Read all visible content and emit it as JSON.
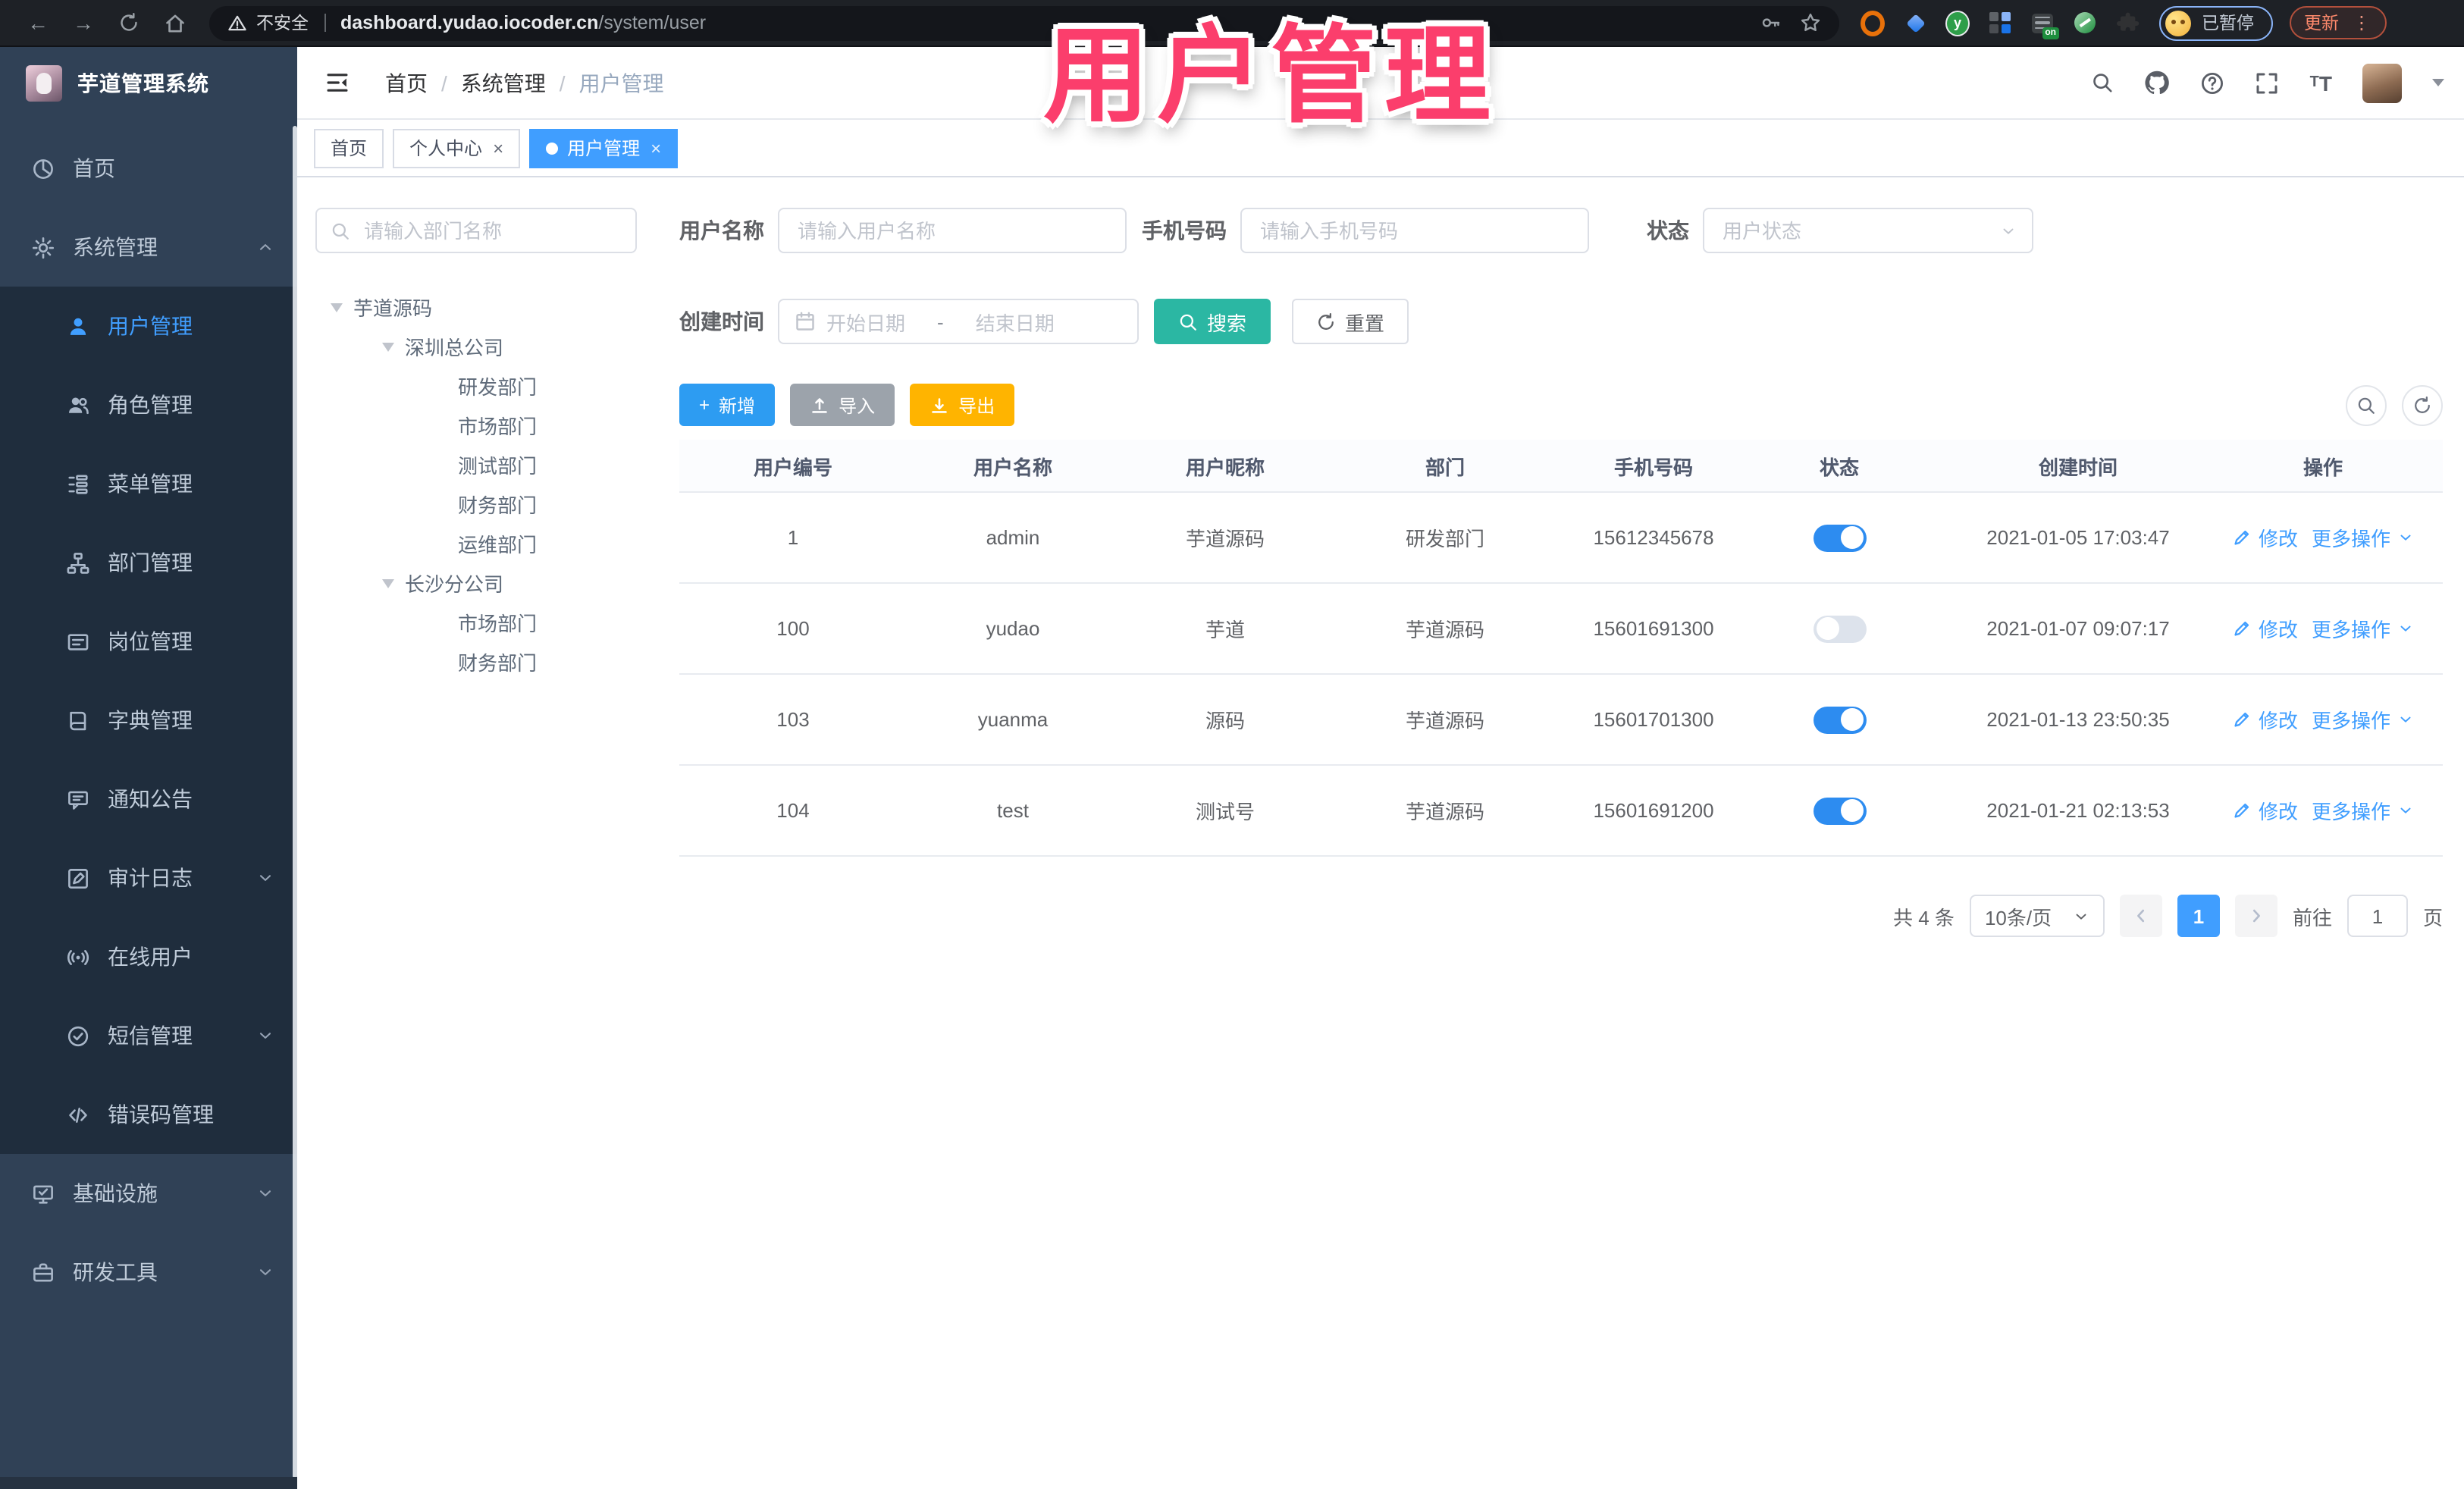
{
  "overlay": {
    "title": "用户管理"
  },
  "theme": {
    "primary": "#409eff",
    "search_button": "#2bb7a3",
    "add_button": "#2d9cf2",
    "import_button": "#9ca3ab",
    "export_button": "#ffb400",
    "overlay_pink": "#fb3e6c",
    "sidebar_bg": "#304156",
    "submenu_bg": "#1f2d3d",
    "toggle_on": "#2d8cf0"
  },
  "browser": {
    "security_label": "不安全",
    "url_host": "dashboard.yudao.iocoder.cn",
    "url_path": "/system/user",
    "profile_status": "已暂停",
    "update_label": "更新"
  },
  "app_header": {
    "logo_title": "芋道管理系统",
    "breadcrumb": [
      "首页",
      "系统管理",
      "用户管理"
    ]
  },
  "tabs": [
    {
      "label": "首页",
      "active": false,
      "closable": false
    },
    {
      "label": "个人中心",
      "active": false,
      "closable": true
    },
    {
      "label": "用户管理",
      "active": true,
      "closable": true
    }
  ],
  "sidebar": {
    "items": [
      {
        "label": "首页",
        "icon": "dashboard-icon",
        "level": "top"
      },
      {
        "label": "系统管理",
        "icon": "gear-icon",
        "level": "top",
        "chevron": "up"
      },
      {
        "label": "用户管理",
        "icon": "user-icon",
        "level": "sub",
        "active": true
      },
      {
        "label": "角色管理",
        "icon": "role-icon",
        "level": "sub"
      },
      {
        "label": "菜单管理",
        "icon": "menu-icon",
        "level": "sub"
      },
      {
        "label": "部门管理",
        "icon": "dept-icon",
        "level": "sub"
      },
      {
        "label": "岗位管理",
        "icon": "post-icon",
        "level": "sub"
      },
      {
        "label": "字典管理",
        "icon": "dict-icon",
        "level": "sub"
      },
      {
        "label": "通知公告",
        "icon": "notice-icon",
        "level": "sub"
      },
      {
        "label": "审计日志",
        "icon": "audit-icon",
        "level": "sub",
        "chevron": "down"
      },
      {
        "label": "在线用户",
        "icon": "online-icon",
        "level": "sub"
      },
      {
        "label": "短信管理",
        "icon": "sms-icon",
        "level": "sub",
        "chevron": "down"
      },
      {
        "label": "错误码管理",
        "icon": "errcode-icon",
        "level": "sub"
      },
      {
        "label": "基础设施",
        "icon": "infra-icon",
        "level": "top",
        "chevron": "down"
      },
      {
        "label": "研发工具",
        "icon": "devtool-icon",
        "level": "top",
        "chevron": "down"
      }
    ]
  },
  "dept_panel": {
    "search_placeholder": "请输入部门名称",
    "tree": [
      {
        "label": "芋道源码",
        "level": 0,
        "caret": true
      },
      {
        "label": "深圳总公司",
        "level": 1,
        "caret": true
      },
      {
        "label": "研发部门",
        "level": 2,
        "caret": false
      },
      {
        "label": "市场部门",
        "level": 2,
        "caret": false
      },
      {
        "label": "测试部门",
        "level": 2,
        "caret": false
      },
      {
        "label": "财务部门",
        "level": 2,
        "caret": false
      },
      {
        "label": "运维部门",
        "level": 2,
        "caret": false
      },
      {
        "label": "长沙分公司",
        "level": 1,
        "caret": true
      },
      {
        "label": "市场部门",
        "level": 2,
        "caret": false
      },
      {
        "label": "财务部门",
        "level": 2,
        "caret": false
      }
    ]
  },
  "filters": {
    "username_label": "用户名称",
    "username_placeholder": "请输入用户名称",
    "mobile_label": "手机号码",
    "mobile_placeholder": "请输入手机号码",
    "status_label": "状态",
    "status_placeholder": "用户状态",
    "create_time_label": "创建时间",
    "date_start_placeholder": "开始日期",
    "date_separator": "-",
    "date_end_placeholder": "结束日期",
    "search_label": "搜索",
    "reset_label": "重置"
  },
  "toolbar": {
    "add_label": "新增",
    "import_label": "导入",
    "export_label": "导出"
  },
  "table": {
    "columns": [
      "用户编号",
      "用户名称",
      "用户昵称",
      "部门",
      "手机号码",
      "状态",
      "创建时间",
      "操作"
    ],
    "ops": {
      "edit": "修改",
      "more": "更多操作"
    },
    "rows": [
      {
        "id": "1",
        "username": "admin",
        "nickname": "芋道源码",
        "dept": "研发部门",
        "mobile": "15612345678",
        "status": true,
        "create_time": "2021-01-05 17:03:47"
      },
      {
        "id": "100",
        "username": "yudao",
        "nickname": "芋道",
        "dept": "芋道源码",
        "mobile": "15601691300",
        "status": false,
        "create_time": "2021-01-07 09:07:17"
      },
      {
        "id": "103",
        "username": "yuanma",
        "nickname": "源码",
        "dept": "芋道源码",
        "mobile": "15601701300",
        "status": true,
        "create_time": "2021-01-13 23:50:35"
      },
      {
        "id": "104",
        "username": "test",
        "nickname": "测试号",
        "dept": "芋道源码",
        "mobile": "15601691200",
        "status": true,
        "create_time": "2021-01-21 02:13:53"
      }
    ]
  },
  "pagination": {
    "total_text": "共 4 条",
    "page_size_text": "10条/页",
    "current_page": "1",
    "goto_label": "前往",
    "goto_value": "1",
    "goto_suffix": "页"
  }
}
